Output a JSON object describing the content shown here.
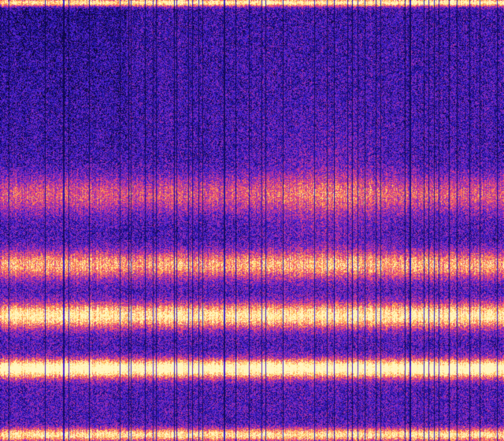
{
  "spectrogram": {
    "colormap": [
      "#0b0630",
      "#1c0f8c",
      "#3a1fd0",
      "#7a2bc8",
      "#c0309a",
      "#ee4a78",
      "#ff8a4a",
      "#ffd86a",
      "#fff6c0"
    ],
    "background_level": 0.22,
    "bands": [
      {
        "center": 0.005,
        "width": 0.006,
        "intensity": 0.85
      },
      {
        "center": 0.44,
        "width": 0.03,
        "intensity": 0.35
      },
      {
        "center": 0.6,
        "width": 0.022,
        "intensity": 0.55
      },
      {
        "center": 0.715,
        "width": 0.02,
        "intensity": 0.75
      },
      {
        "center": 0.835,
        "width": 0.015,
        "intensity": 0.95
      },
      {
        "center": 0.985,
        "width": 0.01,
        "intensity": 0.7
      }
    ],
    "dark_columns": 48
  }
}
